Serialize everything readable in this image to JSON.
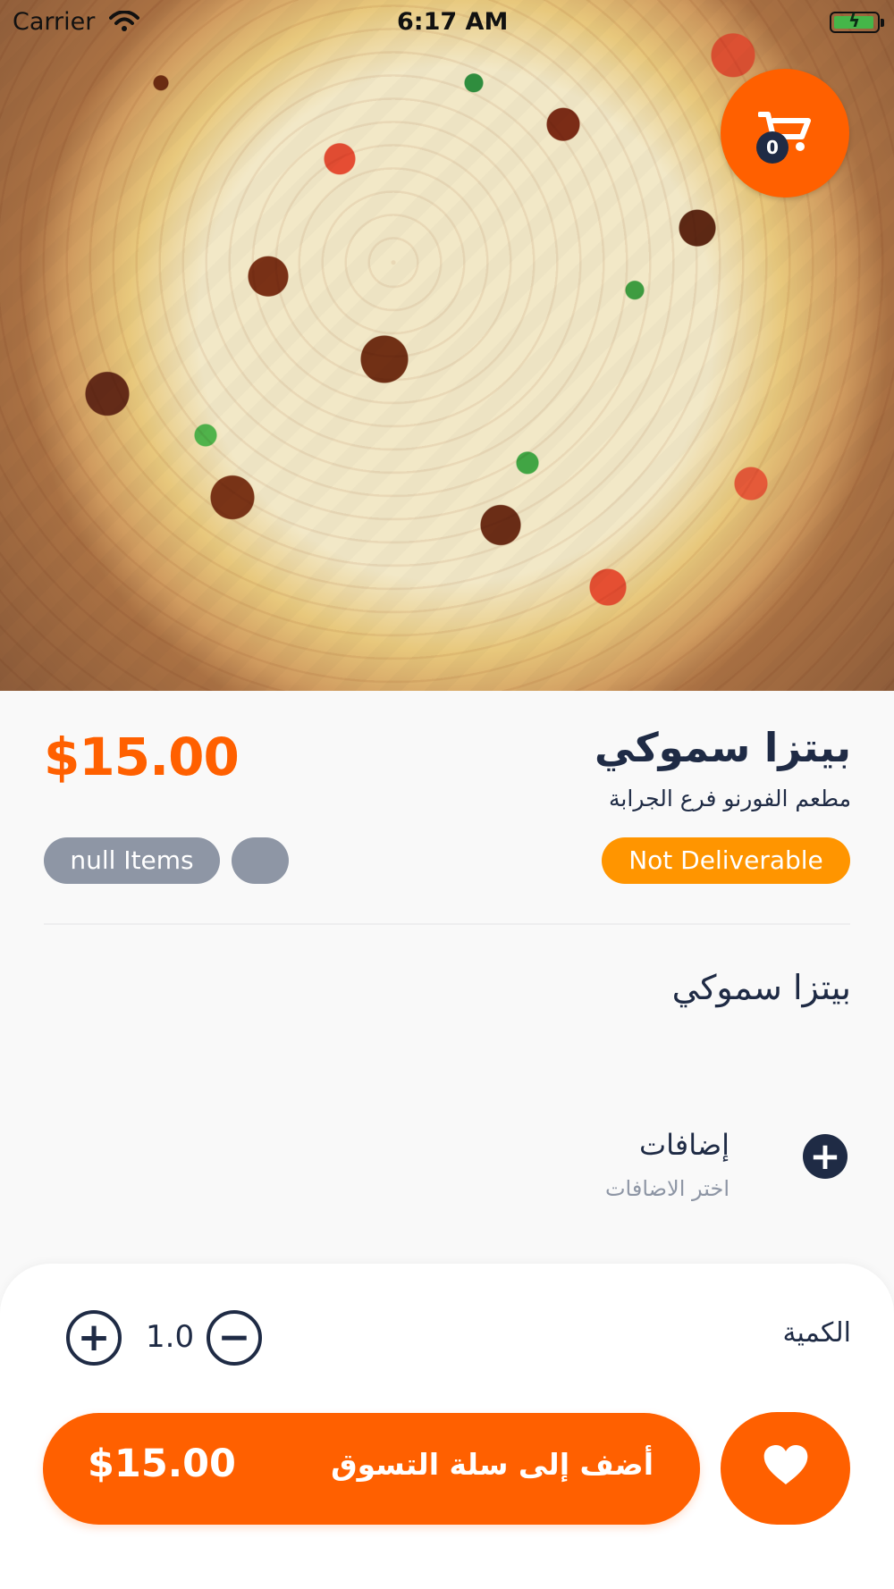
{
  "status_bar": {
    "carrier": "Carrier",
    "time": "6:17 AM",
    "wifi_icon": "wifi-icon",
    "battery_icon": "battery-charging-icon"
  },
  "header": {
    "cart_count": "0",
    "cart_icon": "shopping-cart-icon"
  },
  "product": {
    "price": "$15.00",
    "title": "بيتزا سموكي",
    "restaurant": "مطعم الفورنو فرع الجرابة",
    "items_label": "null Items",
    "deliverable_label": "Not Deliverable",
    "description": "بيتزا سموكي"
  },
  "extras": {
    "title": "إضافات",
    "subtitle": "اختر الاضافات",
    "add_icon": "plus-circle-icon"
  },
  "quantity": {
    "label": "الكمية",
    "value": "1.0",
    "increase_icon": "plus-circle-outline-icon",
    "decrease_icon": "minus-circle-outline-icon"
  },
  "actions": {
    "add_to_cart_label": "أضف إلى سلة التسوق",
    "add_to_cart_price": "$15.00",
    "favorite_icon": "heart-icon"
  },
  "colors": {
    "brand_orange": "#ff6000",
    "deliverable_orange": "#ff9500",
    "navy": "#1f2b45",
    "chip_gray": "#8e96a5"
  }
}
